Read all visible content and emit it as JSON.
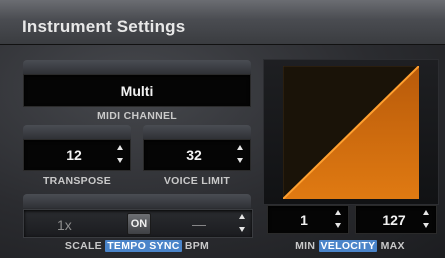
{
  "window": {
    "title": "Instrument Settings"
  },
  "midi": {
    "value": "Multi",
    "label": "MIDI CHANNEL"
  },
  "transpose": {
    "value": "12",
    "label": "TRANSPOSE"
  },
  "voice_limit": {
    "value": "32",
    "label": "VOICE LIMIT"
  },
  "tempo_sync": {
    "scale_value": "1x",
    "toggle_label": "ON",
    "bpm_value": "—",
    "labels": {
      "scale": "SCALE",
      "sync": "TEMPO SYNC",
      "bpm": "BPM"
    }
  },
  "velocity": {
    "min_value": "1",
    "max_value": "127",
    "labels": {
      "min": "MIN",
      "velocity": "VELOCITY",
      "max": "MAX"
    }
  },
  "colors": {
    "accent_orange": "#f08a1a",
    "highlight_blue": "#4a84c9"
  },
  "icons": {
    "spinner": "up-down-arrows-icon"
  }
}
